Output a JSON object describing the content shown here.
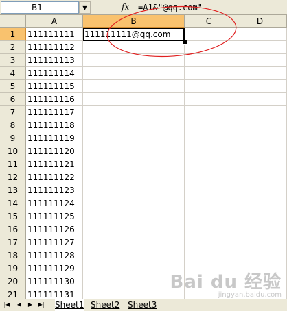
{
  "formula_bar": {
    "name_box": "B1",
    "fx_label": "fx",
    "formula": "=A1&\"@qq.com\""
  },
  "columns": [
    "A",
    "B",
    "C",
    "D"
  ],
  "rows": [
    {
      "num": "1",
      "a": "111111111",
      "b": "111111111@qq.com"
    },
    {
      "num": "2",
      "a": "111111112",
      "b": ""
    },
    {
      "num": "3",
      "a": "111111113",
      "b": ""
    },
    {
      "num": "4",
      "a": "111111114",
      "b": ""
    },
    {
      "num": "5",
      "a": "111111115",
      "b": ""
    },
    {
      "num": "6",
      "a": "111111116",
      "b": ""
    },
    {
      "num": "7",
      "a": "111111117",
      "b": ""
    },
    {
      "num": "8",
      "a": "111111118",
      "b": ""
    },
    {
      "num": "9",
      "a": "111111119",
      "b": ""
    },
    {
      "num": "10",
      "a": "111111120",
      "b": ""
    },
    {
      "num": "11",
      "a": "111111121",
      "b": ""
    },
    {
      "num": "12",
      "a": "111111122",
      "b": ""
    },
    {
      "num": "13",
      "a": "111111123",
      "b": ""
    },
    {
      "num": "14",
      "a": "111111124",
      "b": ""
    },
    {
      "num": "15",
      "a": "111111125",
      "b": ""
    },
    {
      "num": "16",
      "a": "111111126",
      "b": ""
    },
    {
      "num": "17",
      "a": "111111127",
      "b": ""
    },
    {
      "num": "18",
      "a": "111111128",
      "b": ""
    },
    {
      "num": "19",
      "a": "111111129",
      "b": ""
    },
    {
      "num": "20",
      "a": "111111130",
      "b": ""
    },
    {
      "num": "21",
      "a": "111111131",
      "b": ""
    }
  ],
  "selected_cell": "B1",
  "sheet_tabs": [
    "Sheet1",
    "Sheet2",
    "Sheet3"
  ],
  "active_sheet": "Sheet1",
  "nav_icons": [
    "first-sheet-icon",
    "prev-sheet-icon",
    "next-sheet-icon",
    "last-sheet-icon"
  ],
  "annotation_color": "#e02020",
  "highlight_color": "#f9c26e",
  "watermark": {
    "logo": "Bai du 经验",
    "sub": "jingyan.baidu.com"
  }
}
